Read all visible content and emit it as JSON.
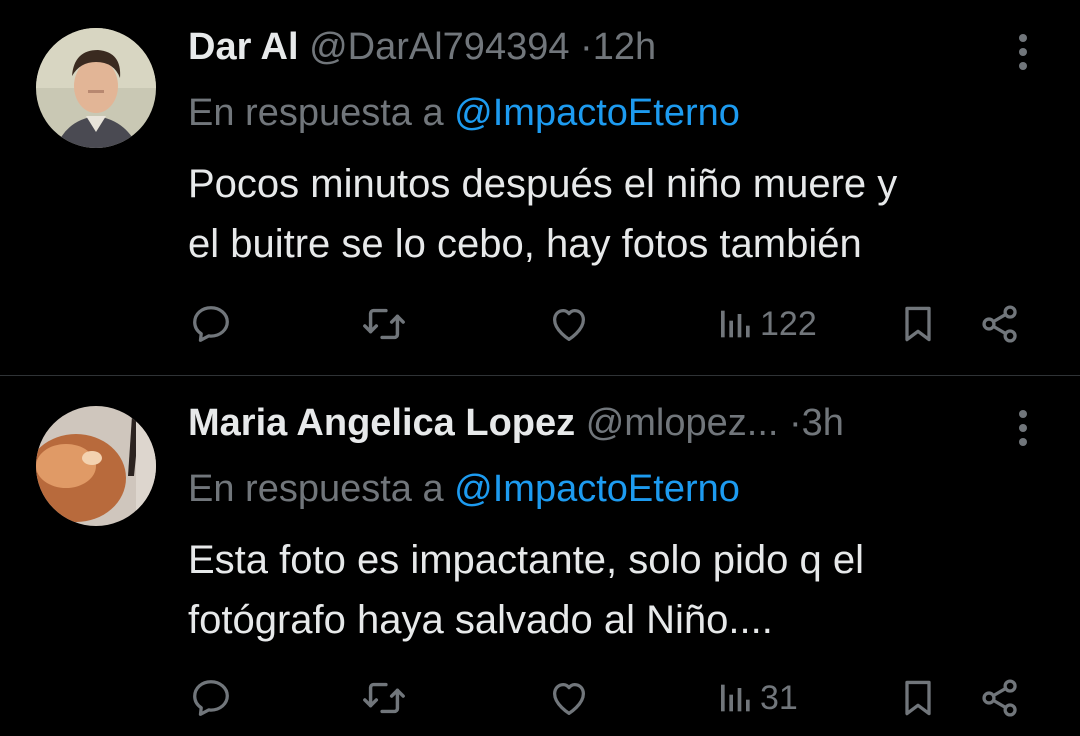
{
  "colors": {
    "background": "#000000",
    "text": "#e7e9ea",
    "muted": "#71767b",
    "accent": "#1d9bf0",
    "divider": "#2f3336"
  },
  "tweets": [
    {
      "name": "Dar Al",
      "handle": "@DarAl794394",
      "separator": "·",
      "time": "12h",
      "reply_prefix": "En respuesta a",
      "reply_to": "@ImpactoEterno",
      "text_line1": "Pocos minutos después el niño muere y",
      "text_line2": "el buitre se lo cebo, hay fotos también",
      "views": "122",
      "icons": [
        "reply-icon",
        "retweet-icon",
        "like-icon",
        "views-icon",
        "bookmark-icon",
        "share-icon",
        "more-icon"
      ]
    },
    {
      "name": "Maria Angelica Lopez",
      "handle": "@mlopez...",
      "separator": "·",
      "time": "3h",
      "reply_prefix": "En respuesta a",
      "reply_to": "@ImpactoEterno",
      "text_line1": "Esta foto es impactante, solo pido q el",
      "text_line2": "fotógrafo haya salvado al Niño....",
      "views": "31",
      "icons": [
        "reply-icon",
        "retweet-icon",
        "like-icon",
        "views-icon",
        "bookmark-icon",
        "share-icon",
        "more-icon"
      ]
    }
  ]
}
